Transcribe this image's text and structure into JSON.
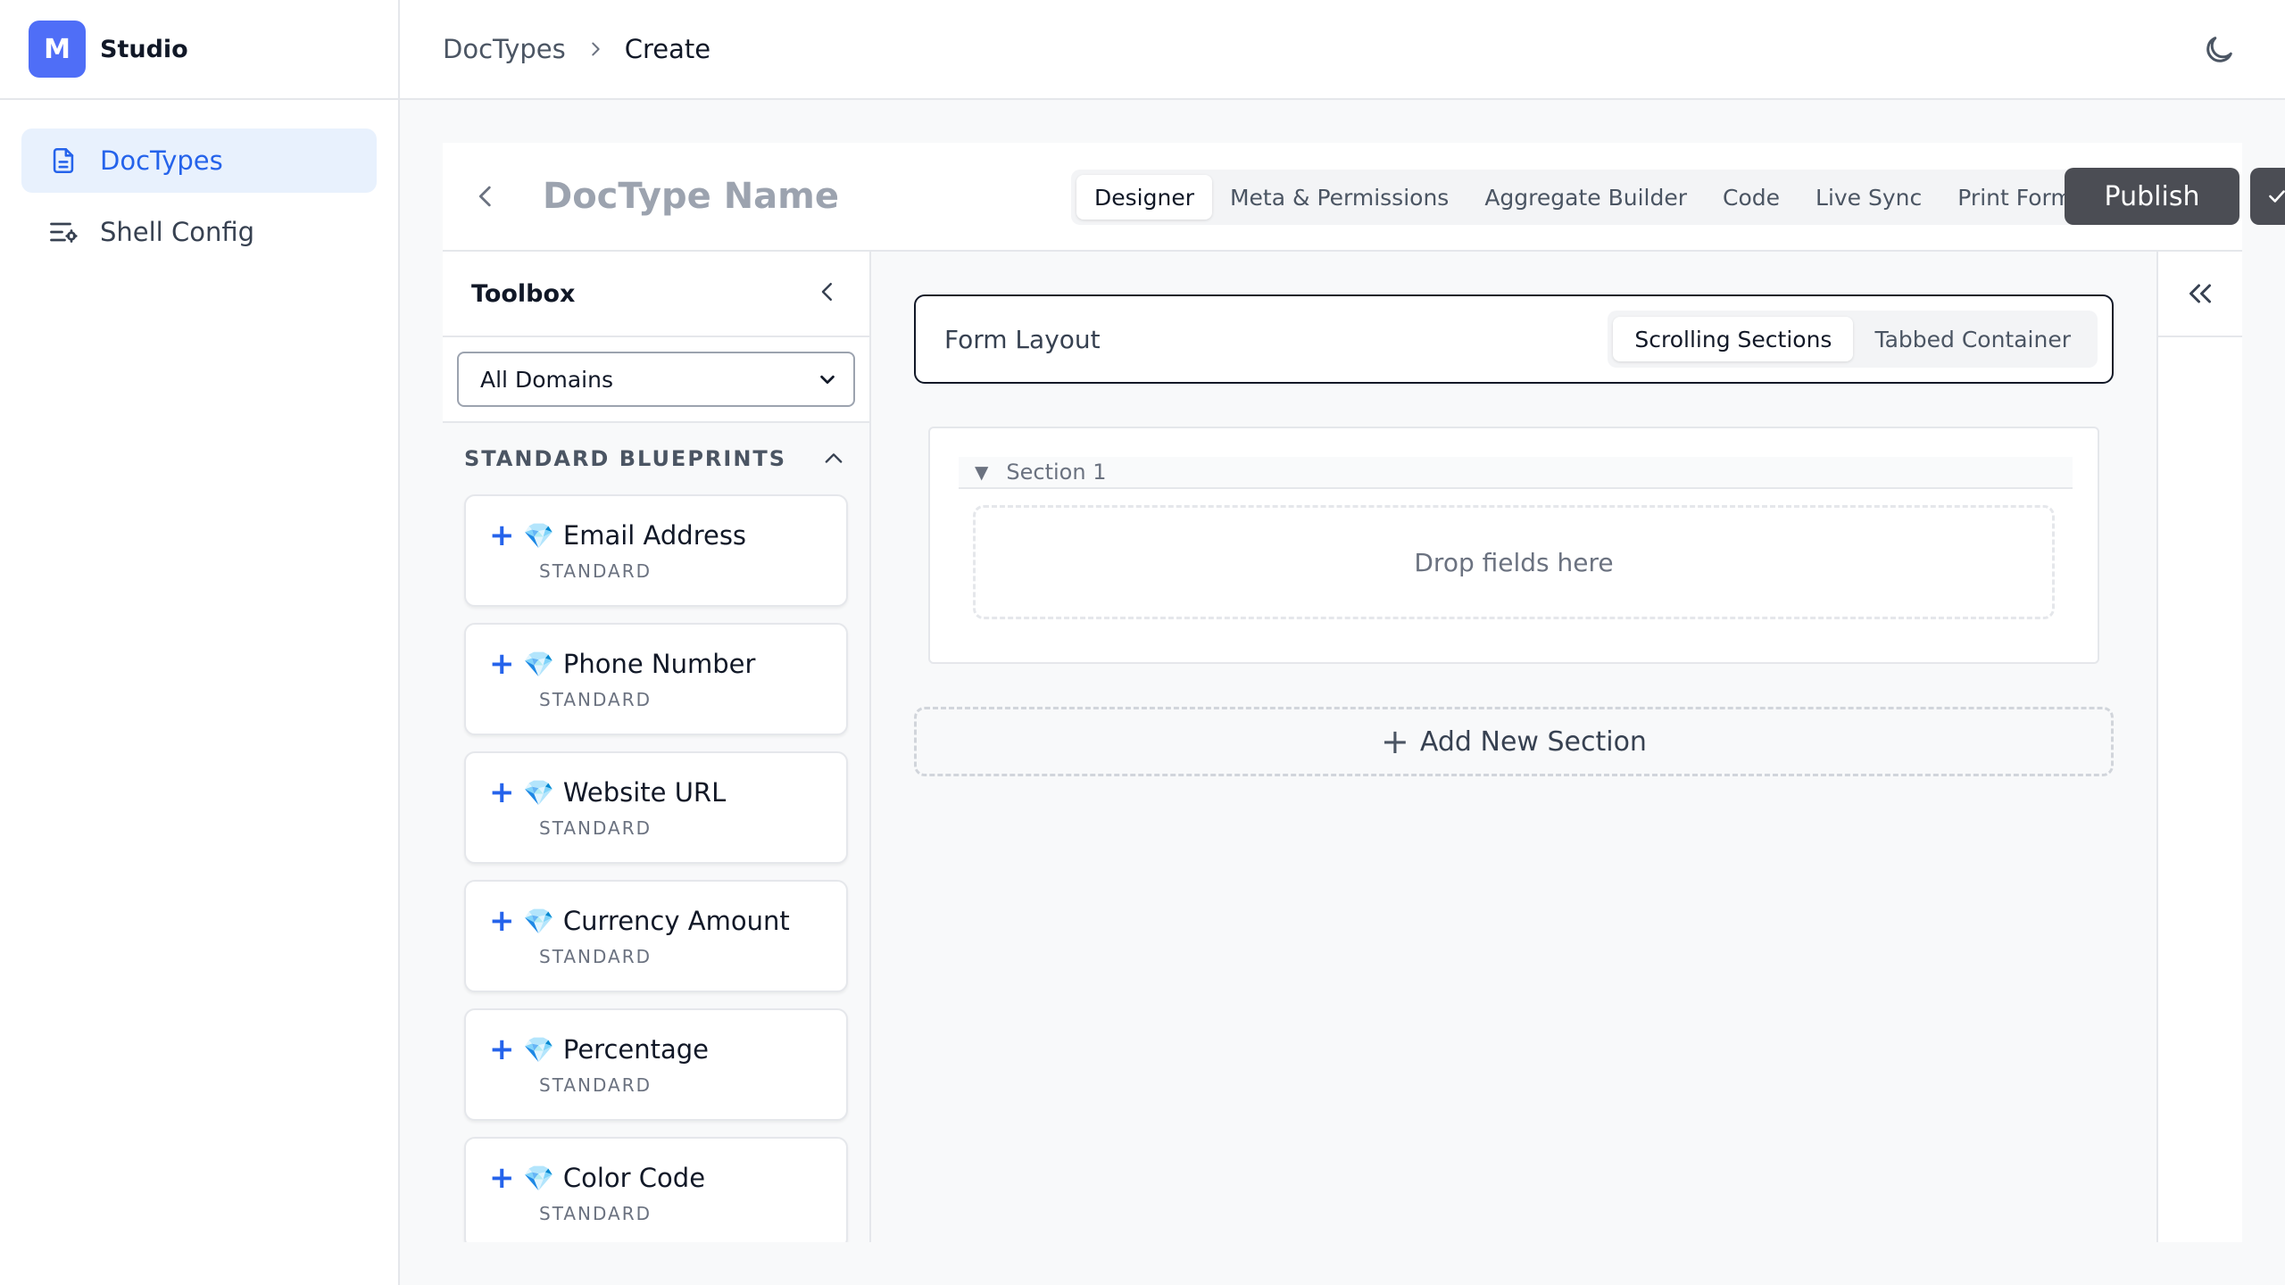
{
  "brand": {
    "logo_letter": "M",
    "name": "Studio"
  },
  "sidebar": {
    "items": [
      {
        "label": "DocTypes",
        "icon": "document-icon",
        "active": true
      },
      {
        "label": "Shell Config",
        "icon": "settings-list-icon",
        "active": false
      }
    ]
  },
  "breadcrumb": {
    "parent": "DocTypes",
    "current": "Create"
  },
  "header": {
    "theme_icon": "moon-icon"
  },
  "editor": {
    "doc_name_placeholder": "DocType Name",
    "tabs": [
      "Designer",
      "Meta & Permissions",
      "Aggregate Builder",
      "Code",
      "Live Sync",
      "Print Formats"
    ],
    "active_tab": "Designer",
    "publish_label": "Publish"
  },
  "toolbox": {
    "title": "Toolbox",
    "domain_select": "All Domains",
    "blueprints_title": "STANDARD BLUEPRINTS",
    "items": [
      {
        "label": "Email Address",
        "tag": "STANDARD",
        "icon": "gem-icon"
      },
      {
        "label": "Phone Number",
        "tag": "STANDARD",
        "icon": "gem-icon"
      },
      {
        "label": "Website URL",
        "tag": "STANDARD",
        "icon": "gem-icon"
      },
      {
        "label": "Currency Amount",
        "tag": "STANDARD",
        "icon": "gem-icon"
      },
      {
        "label": "Percentage",
        "tag": "STANDARD",
        "icon": "gem-icon"
      },
      {
        "label": "Color Code",
        "tag": "STANDARD",
        "icon": "gem-icon"
      }
    ]
  },
  "canvas": {
    "layout_label": "Form Layout",
    "layout_options": [
      "Scrolling Sections",
      "Tabbed Container"
    ],
    "active_layout": "Scrolling Sections",
    "section_title": "Section 1",
    "dropzone_text": "Drop fields here",
    "add_section_label": "Add New Section"
  },
  "colors": {
    "accent": "#2563eb",
    "brand": "#4f6ef7",
    "publish_bg": "#4b4d54",
    "active_nav_bg": "#e8f1fd"
  }
}
